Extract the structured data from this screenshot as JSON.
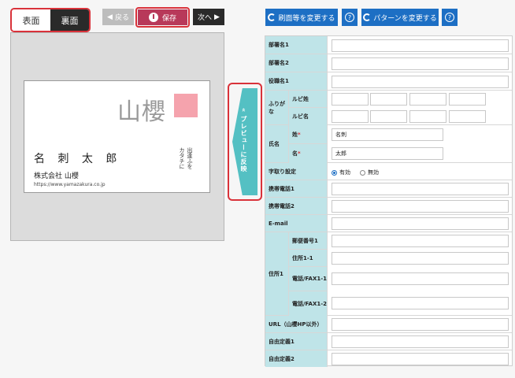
{
  "tabs": {
    "front": "表面",
    "back": "裏面"
  },
  "toolbar": {
    "back": "戻る",
    "save": "保存",
    "next": "次へ"
  },
  "actions": {
    "change_font": "刷面等を変更する",
    "change_pattern": "パターンを変更する",
    "help": "?"
  },
  "card": {
    "logo_text": "山櫻",
    "name": "名 刺 太 郎",
    "company": "株式会社 山櫻",
    "url": "https://www.yamazakura.co.jp",
    "vertical1": "出逢ふを",
    "vertical2": "カタチに"
  },
  "reflect": {
    "label": "« プレビューに反映"
  },
  "form": {
    "dept1": "部署名1",
    "dept2": "部署名2",
    "title1": "役職名1",
    "furigana": "ふりがな",
    "ruby_last": "ルビ姓",
    "ruby_first": "ルビ名",
    "name": "氏名",
    "last": "姓",
    "first": "名",
    "required_mark": "*",
    "last_value": "名刺",
    "first_value": "太郎",
    "kerning": "字取り設定",
    "enabled": "有効",
    "disabled": "無効",
    "mobile1": "携帯電話1",
    "mobile2": "携帯電話2",
    "email": "E-mail",
    "address1": "住所1",
    "postal1": "郵便番号1",
    "addr_line": "住所1-1",
    "tel_fax1": "電話/FAX1-1",
    "tel_fax2": "電話/FAX1-2",
    "url": "URL（山櫻HP以外）",
    "custom1": "自由定義1",
    "custom2": "自由定義2"
  },
  "colors": {
    "accent_red": "#d9323a",
    "teal": "#54c0c3",
    "blue": "#1d6fc4",
    "label_bg": "#bfe4e8"
  }
}
